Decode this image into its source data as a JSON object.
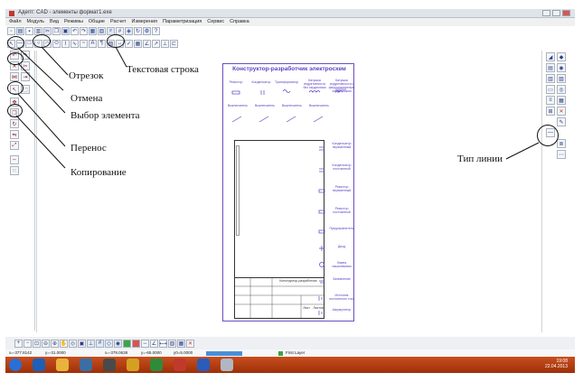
{
  "window": {
    "title": "Адепт: CAD - элементы формат1.exe"
  },
  "menu": {
    "items": [
      "Файл",
      "Модуль",
      "Вид",
      "Режимы",
      "Общие",
      "Расчет",
      "Измерения",
      "Параметризация",
      "Сервис",
      "Справка"
    ]
  },
  "annotations": {
    "segment": "Отрезок",
    "undo": "Отмена",
    "select": "Выбор элемента",
    "move": "Перенос",
    "copy": "Копирование",
    "text_line": "Текстовая строка",
    "line_type": "Тип линии"
  },
  "sheet": {
    "title": "Конструктор-разработчик электросхем",
    "symbols": [
      "Резистор",
      "Конденсатор",
      "Трансформатор",
      "Катушка индуктивности без сердечника",
      "Катушка индуктивности с ферромагнитным сердечником",
      "Выключатель",
      "Конденсатор переменный",
      "Конденсатор постоянный",
      "Резистор переменный",
      "Резистор постоянный",
      "Предохранитель",
      "Диод",
      "Лампа накаливания",
      "Заземление",
      "Источник постоянного тока",
      "Аккумулятор"
    ],
    "stamp_text": [
      "Конструктор-разработчик",
      "Лист",
      "Листов"
    ]
  },
  "status": {
    "layer": "First Layer",
    "coords": [
      "x=-377.8142",
      "y=-31.0000",
      "x=-379.0638",
      "y=-65.0000",
      "y0=5.0000"
    ]
  },
  "clock": {
    "time": "19:08",
    "date": "22.04.2013"
  }
}
